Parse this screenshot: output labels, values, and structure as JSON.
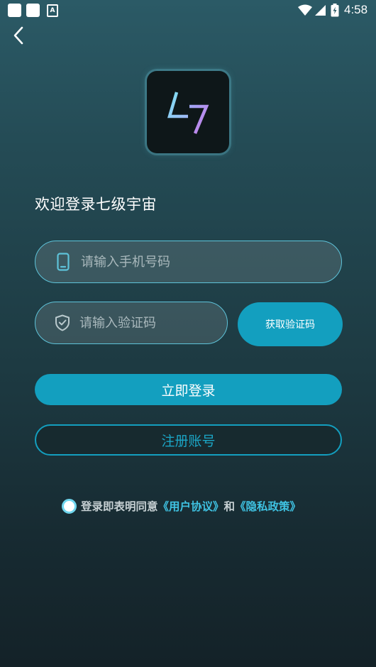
{
  "status_bar": {
    "time": "4:58",
    "a_badge": "A",
    "icons": [
      "notification-square-icon",
      "notification-square-icon",
      "a-badge-icon",
      "wifi-icon",
      "cell-signal-icon",
      "battery-charging-icon"
    ]
  },
  "header": {
    "back_icon": "back-arrow-icon"
  },
  "logo": {
    "icon": "app-logo-47"
  },
  "welcome": {
    "title": "欢迎登录七级宇宙"
  },
  "form": {
    "phone": {
      "icon": "phone-icon",
      "placeholder": "请输入手机号码",
      "value": ""
    },
    "code": {
      "icon": "shield-check-icon",
      "placeholder": "请输入验证码",
      "value": ""
    },
    "get_code_label": "获取验证码",
    "login_label": "立即登录",
    "register_label": "注册账号"
  },
  "agreement": {
    "prefix": "登录即表明同意",
    "user_agreement": "《用户协议》",
    "conjunction": "和",
    "privacy_policy": "《隐私政策》"
  },
  "colors": {
    "accent": "#139fbf",
    "field_border": "#5ec3d9",
    "link": "#3fc2e2"
  }
}
